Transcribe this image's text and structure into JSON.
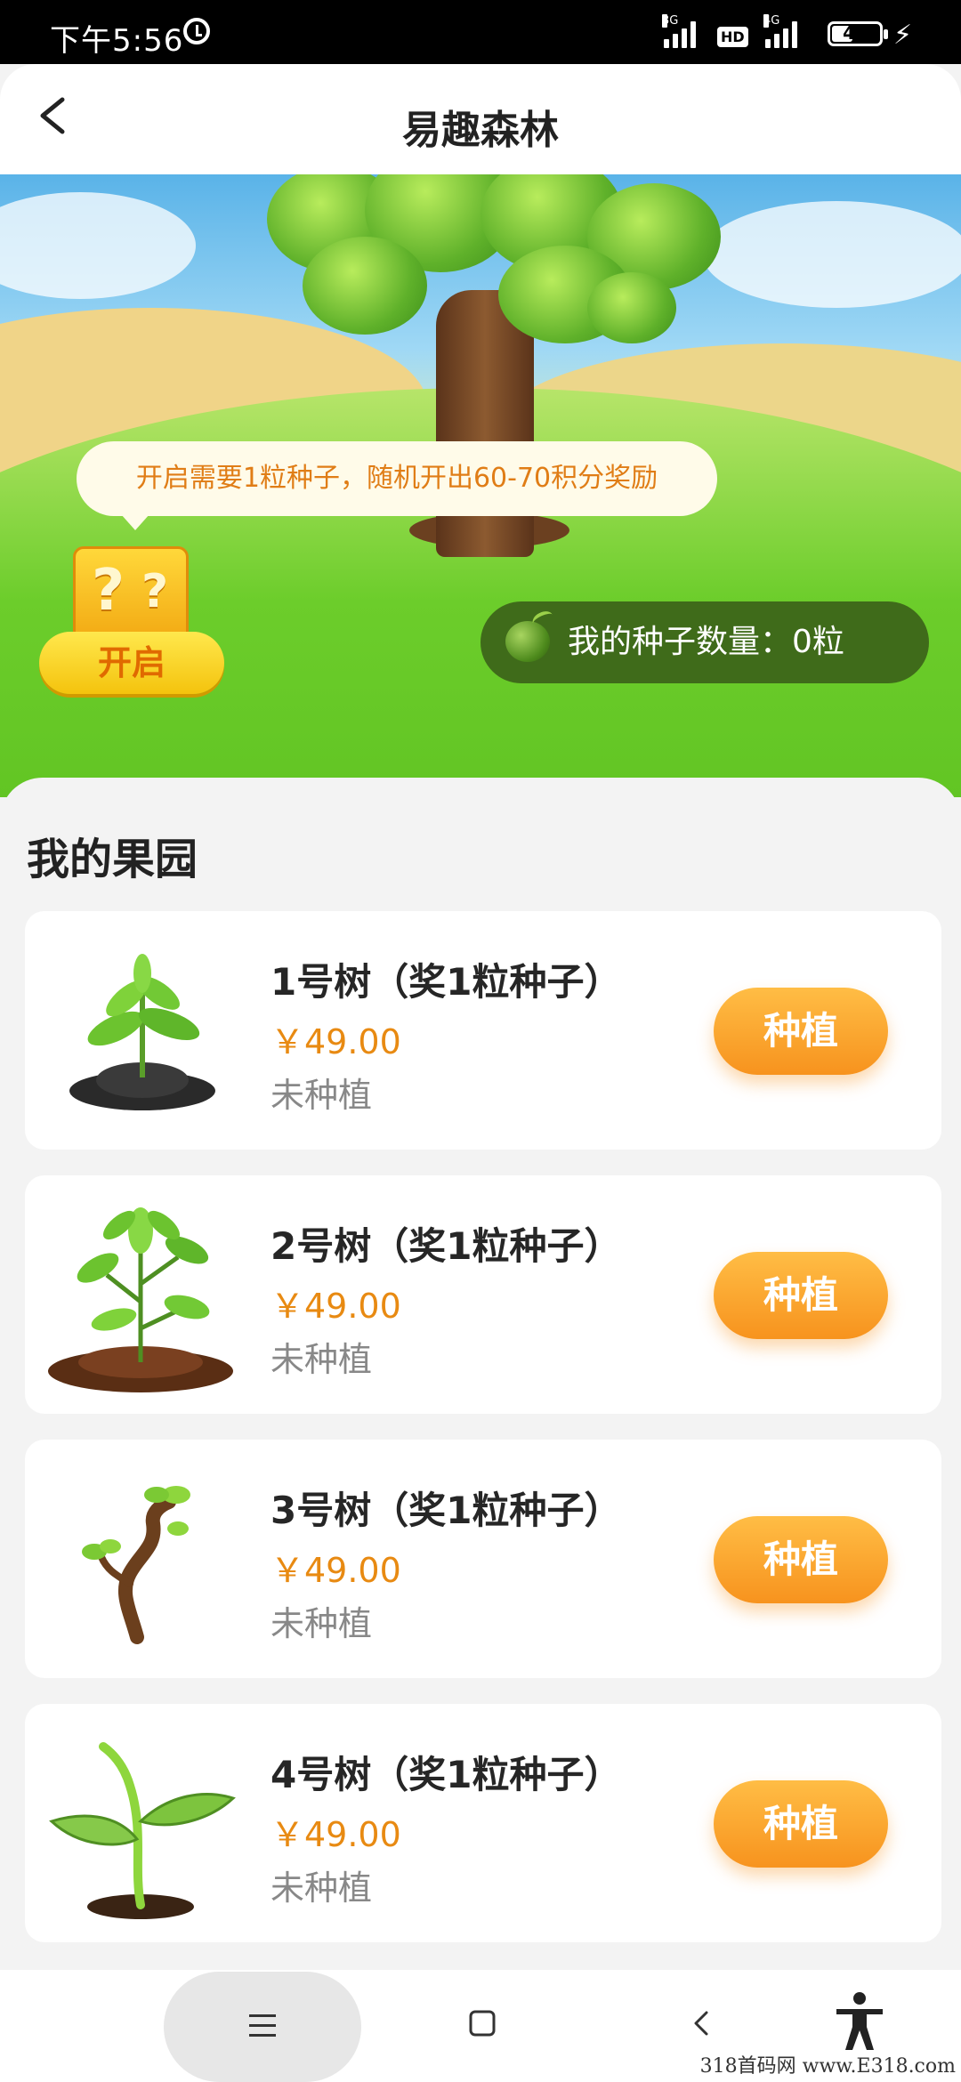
{
  "status_bar": {
    "time": "下午5:56",
    "signal1_label": "3G",
    "hd_label": "HD",
    "signal2_label": "4G",
    "battery": "45",
    "battery_level": 0.45
  },
  "header": {
    "title": "易趣森林"
  },
  "hero": {
    "tooltip": "开启需要1粒种子，随机开出60-70积分奖励",
    "box_glyph": "?",
    "open_button": "开启",
    "seed_count": "我的种子数量：0粒"
  },
  "orchard": {
    "title": "我的果园",
    "trees": [
      {
        "name": "1号树（奖1粒种子）",
        "price": "￥49.00",
        "status": "未种植",
        "button": "种植",
        "image": "sprout-with-soil-icon"
      },
      {
        "name": "2号树（奖1粒种子）",
        "price": "￥49.00",
        "status": "未种植",
        "button": "种植",
        "image": "leafy-sapling-icon"
      },
      {
        "name": "3号树（奖1粒种子）",
        "price": "￥49.00",
        "status": "未种植",
        "button": "种植",
        "image": "twisted-bonsai-sprout-icon"
      },
      {
        "name": "4号树（奖1粒种子）",
        "price": "￥49.00",
        "status": "未种植",
        "button": "种植",
        "image": "seedling-icon"
      }
    ]
  },
  "nav": {
    "menu": "☰",
    "home": "□",
    "back": "‹"
  },
  "watermark": "318首码网 www.E318.com",
  "colors": {
    "accent_orange": "#f7931e",
    "price_orange": "#e88a12",
    "grass_green": "#5cc01f",
    "seed_pill": "#3f6b1a"
  }
}
